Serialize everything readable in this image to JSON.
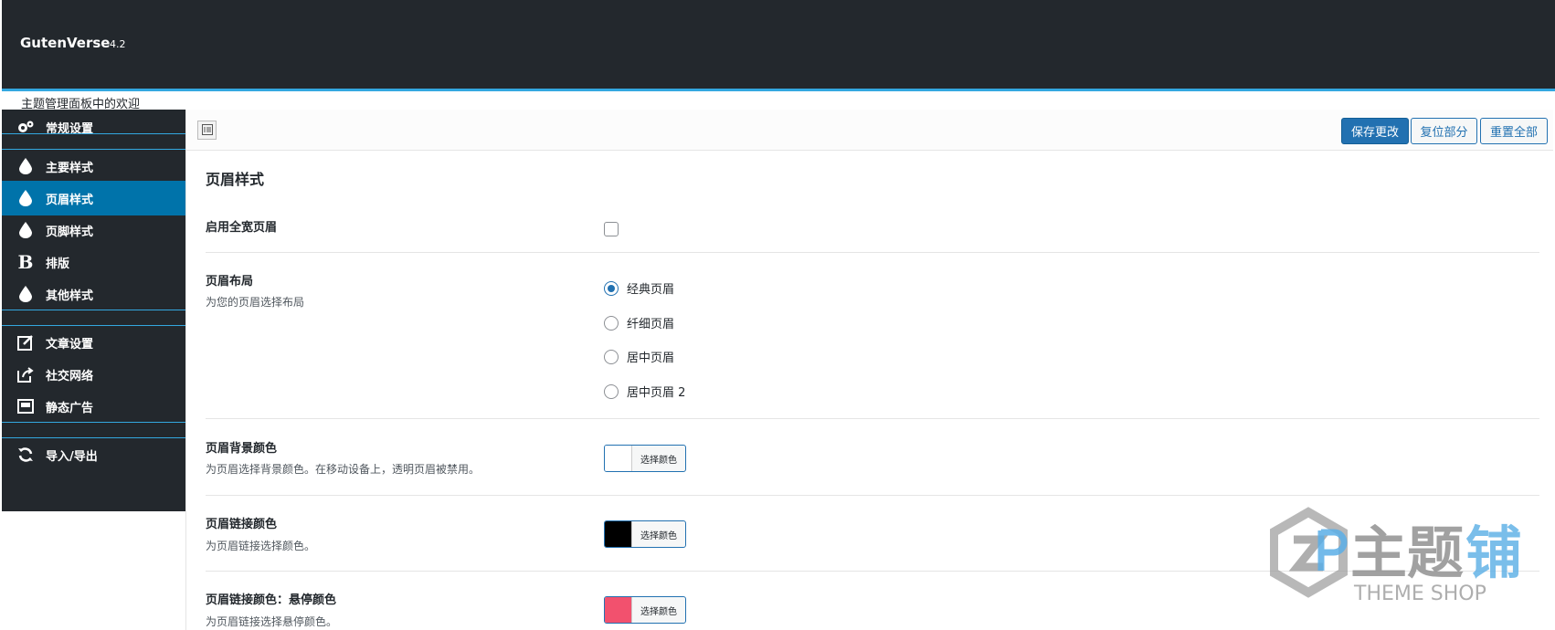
{
  "header": {
    "brand": "GutenVerse",
    "version": "4.2"
  },
  "welcome": "主题管理面板中的欢迎",
  "sidebar": {
    "items": [
      {
        "label": "常规设置",
        "icon": "gears-icon"
      },
      {
        "label": "主要样式",
        "icon": "drop-icon"
      },
      {
        "label": "页眉样式",
        "icon": "drop-icon",
        "active": true
      },
      {
        "label": "页脚样式",
        "icon": "drop-icon"
      },
      {
        "label": "排版",
        "icon": "bold-icon"
      },
      {
        "label": "其他样式",
        "icon": "drop-icon"
      },
      {
        "label": "文章设置",
        "icon": "edit-icon"
      },
      {
        "label": "社交网络",
        "icon": "share-icon"
      },
      {
        "label": "静态广告",
        "icon": "ad-icon"
      },
      {
        "label": "导入/导出",
        "icon": "refresh-icon"
      }
    ]
  },
  "toolbar": {
    "save_label": "保存更改",
    "reset_section_label": "复位部分",
    "reset_all_label": "重置全部"
  },
  "main": {
    "section_title": "页眉样式",
    "full_width": {
      "label": "启用全宽页眉",
      "checked": false
    },
    "layout": {
      "label": "页眉布局",
      "desc": "为您的页眉选择布局",
      "options": [
        "经典页眉",
        "纤细页眉",
        "居中页眉",
        "居中页眉 2"
      ],
      "selected": "经典页眉"
    },
    "bg_color": {
      "label": "页眉背景颜色",
      "desc": "为页眉选择背景颜色。在移动设备上，透明页眉被禁用。",
      "button": "选择颜色",
      "value": "#ffffff"
    },
    "link_color": {
      "label": "页眉链接颜色",
      "desc": "为页眉链接选择颜色。",
      "button": "选择颜色",
      "value": "#000000"
    },
    "hover_color": {
      "label": "页眉链接颜色：悬停颜色",
      "desc": "为页眉链接选择悬停颜色。",
      "button": "选择颜色",
      "value": "#f2516e"
    }
  },
  "watermark": {
    "cn": "主题铺",
    "en": "THEME SHOP"
  },
  "colors": {
    "dark": "#23282d",
    "accent": "#33a8e0",
    "active": "#0073aa",
    "primary": "#2271b1"
  }
}
